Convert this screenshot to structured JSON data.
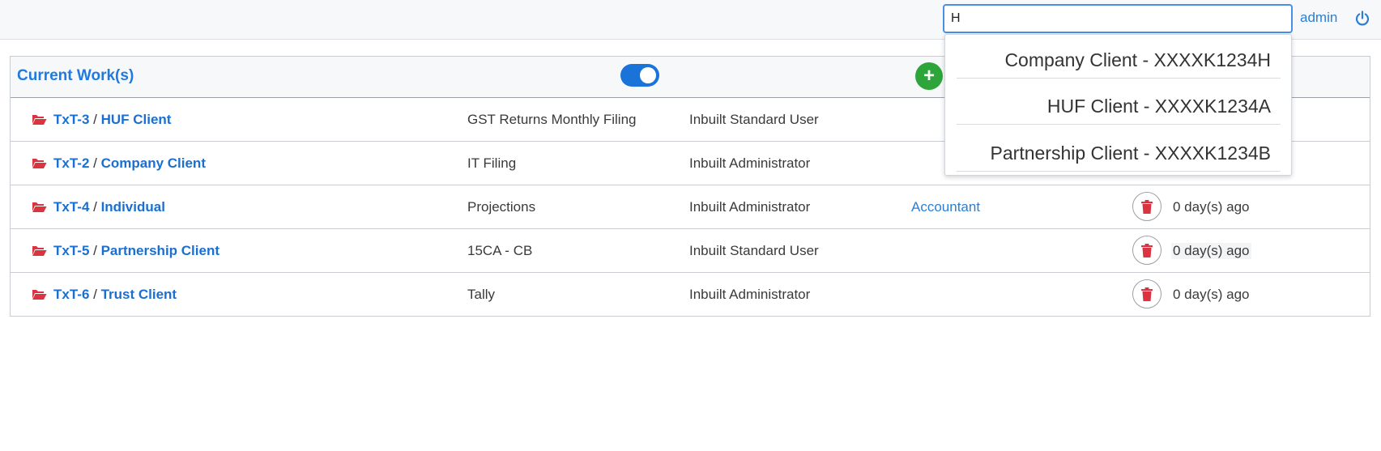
{
  "header": {
    "search": {
      "value": "H",
      "placeholder": ""
    },
    "user_link": "admin",
    "power_icon": "power-icon"
  },
  "panel": {
    "title": "Current Work(s)",
    "toggle_on": true,
    "add_icon": "+"
  },
  "rows": [
    {
      "code": "TxT-3",
      "sep": " / ",
      "client": "HUF Client",
      "type": "GST Returns Monthly Filing",
      "user": "Inbuilt Standard User",
      "role": "",
      "ago": ""
    },
    {
      "code": "TxT-2",
      "sep": " / ",
      "client": "Company Client",
      "type": "IT Filing",
      "user": "Inbuilt Administrator",
      "role": "",
      "ago": ""
    },
    {
      "code": "TxT-4",
      "sep": " / ",
      "client": "Individual",
      "type": "Projections",
      "user": "Inbuilt Administrator",
      "role": "Accountant",
      "ago": "0 day(s) ago"
    },
    {
      "code": "TxT-5",
      "sep": " / ",
      "client": "Partnership Client",
      "type": "15CA - CB",
      "user": "Inbuilt Standard User",
      "role": "",
      "ago": "0 day(s) ago"
    },
    {
      "code": "TxT-6",
      "sep": " / ",
      "client": "Trust Client",
      "type": "Tally",
      "user": "Inbuilt Administrator",
      "role": "",
      "ago": "0 day(s) ago"
    }
  ],
  "dropdown": {
    "items": [
      "Company Client - XXXXK1234H",
      "HUF Client - XXXXK1234A",
      "Partnership Client - XXXXK1234B"
    ]
  },
  "colors": {
    "accent": "#1f7ae0",
    "folder": "#d9343f",
    "delete": "#d9343f",
    "add": "#2ea53a",
    "toggle": "#1a73d9"
  }
}
